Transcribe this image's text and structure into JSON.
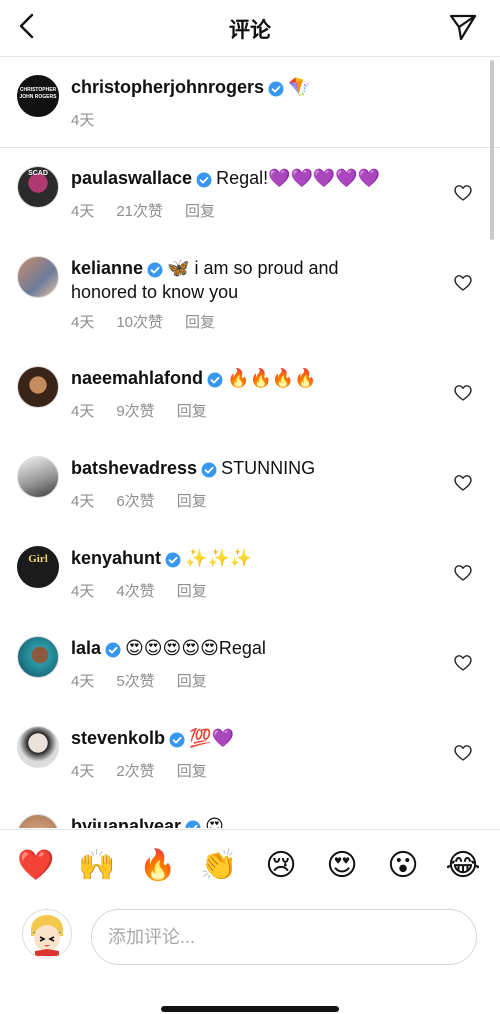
{
  "header": {
    "title": "评论"
  },
  "caption": {
    "username": "christopherjohnrogers",
    "emoji": "🪁",
    "time": "4天",
    "avatar_lines": [
      "CHRISTOPHER",
      "JOHN ROGERS"
    ]
  },
  "comments": [
    {
      "username": "paulaswallace",
      "text": "Regal!💜💜💜💜💜",
      "time": "4天",
      "likes": "21次赞",
      "reply": "回复"
    },
    {
      "username": "kelianne",
      "text": "🦋 i am so proud and honored to know you",
      "time": "4天",
      "likes": "10次赞",
      "reply": "回复"
    },
    {
      "username": "naeemahlafond",
      "text": "🔥🔥🔥🔥",
      "time": "4天",
      "likes": "9次赞",
      "reply": "回复"
    },
    {
      "username": "batshevadress",
      "text": "STUNNING",
      "time": "4天",
      "likes": "6次赞",
      "reply": "回复"
    },
    {
      "username": "kenyahunt",
      "text": "✨✨✨",
      "time": "4天",
      "likes": "4次赞",
      "reply": "回复"
    },
    {
      "username": "lala",
      "text": "😍😍😍😍😍Regal",
      "time": "4天",
      "likes": "5次赞",
      "reply": "回复"
    },
    {
      "username": "stevenkolb",
      "text": "💯💜",
      "time": "4天",
      "likes": "2次赞",
      "reply": "回复"
    },
    {
      "username": "byjuanalvear",
      "text": "😍",
      "time": "",
      "likes": "",
      "reply": ""
    }
  ],
  "quick_emojis": [
    "❤️",
    "🙌",
    "🔥",
    "👏",
    "😢",
    "😍",
    "😮",
    "😂"
  ],
  "input": {
    "placeholder": "添加评论..."
  },
  "avatar_texts": {
    "kenyahunt": "Girl",
    "paulaswallace": "SCAD"
  },
  "colors": {
    "verified": "#3897f0",
    "heart": "#262626",
    "meta": "#8e8e8e",
    "border": "#e6e6e6"
  },
  "icons": {
    "back": "chevron-left-icon",
    "send": "paper-plane-icon",
    "like": "heart-outline-icon",
    "verified": "verified-badge-icon"
  }
}
